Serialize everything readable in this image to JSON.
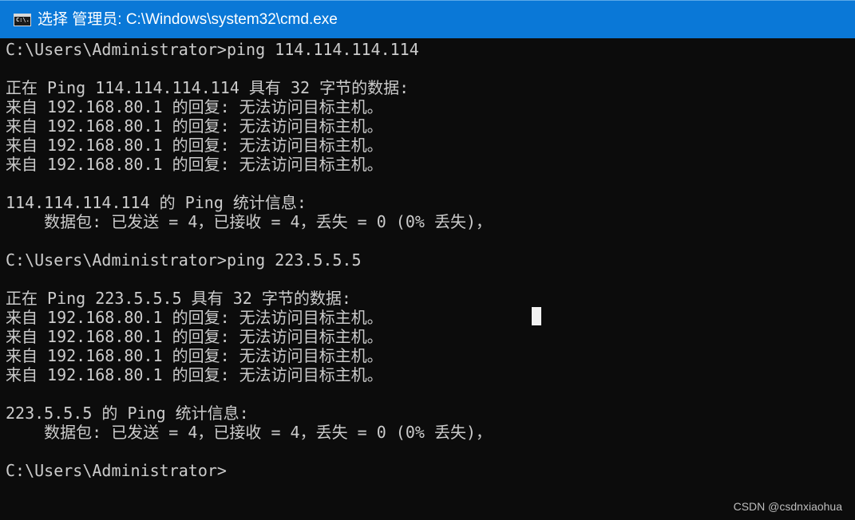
{
  "window": {
    "title": "选择 管理员: C:\\Windows\\system32\\cmd.exe",
    "icon": "cmd-icon",
    "icon_text": "C:\\."
  },
  "console": {
    "lines": [
      "C:\\Users\\Administrator>ping 114.114.114.114",
      "",
      "正在 Ping 114.114.114.114 具有 32 字节的数据:",
      "来自 192.168.80.1 的回复: 无法访问目标主机。",
      "来自 192.168.80.1 的回复: 无法访问目标主机。",
      "来自 192.168.80.1 的回复: 无法访问目标主机。",
      "来自 192.168.80.1 的回复: 无法访问目标主机。",
      "",
      "114.114.114.114 的 Ping 统计信息:",
      "    数据包: 已发送 = 4，已接收 = 4，丢失 = 0 (0% 丢失)，",
      "",
      "C:\\Users\\Administrator>ping 223.5.5.5",
      "",
      "正在 Ping 223.5.5.5 具有 32 字节的数据:",
      "来自 192.168.80.1 的回复: 无法访问目标主机。",
      "来自 192.168.80.1 的回复: 无法访问目标主机。",
      "来自 192.168.80.1 的回复: 无法访问目标主机。",
      "来自 192.168.80.1 的回复: 无法访问目标主机。",
      "",
      "223.5.5.5 的 Ping 统计信息:",
      "    数据包: 已发送 = 4，已接收 = 4，丢失 = 0 (0% 丢失)，",
      "",
      "C:\\Users\\Administrator>"
    ]
  },
  "watermark": "CSDN @csdnxiaohua",
  "colors": {
    "titlebar": "#0a78d7",
    "console_background": "#0c0c0c",
    "console_text": "#cccccc"
  }
}
